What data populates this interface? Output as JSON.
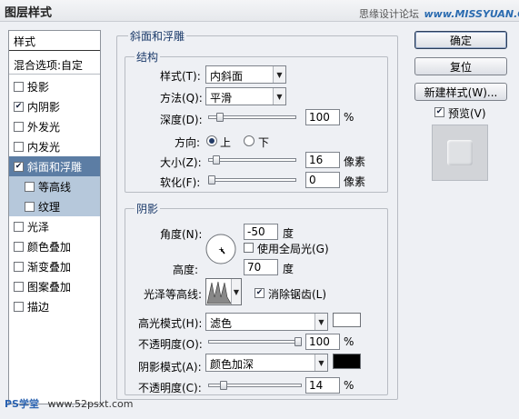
{
  "window": {
    "title": "图层样式"
  },
  "watermark": {
    "text": "思缘设计论坛",
    "site": "www.MISSYUAN.COM"
  },
  "sidebar": {
    "header": "样式",
    "blend_options": "混合选项:自定",
    "items": [
      {
        "label": "投影",
        "checked": false
      },
      {
        "label": "内阴影",
        "checked": true
      },
      {
        "label": "外发光",
        "checked": false
      },
      {
        "label": "内发光",
        "checked": false
      },
      {
        "label": "斜面和浮雕",
        "checked": true,
        "selected": true
      },
      {
        "label": "等高线",
        "checked": false,
        "sub": true
      },
      {
        "label": "纹理",
        "checked": false,
        "sub": true
      },
      {
        "label": "光泽",
        "checked": false
      },
      {
        "label": "颜色叠加",
        "checked": false
      },
      {
        "label": "渐变叠加",
        "checked": false
      },
      {
        "label": "图案叠加",
        "checked": false
      },
      {
        "label": "描边",
        "checked": false
      }
    ]
  },
  "bevel": {
    "group_title": "斜面和浮雕",
    "structure": {
      "title": "结构",
      "style_label": "样式(T):",
      "style_value": "内斜面",
      "technique_label": "方法(Q):",
      "technique_value": "平滑",
      "depth_label": "深度(D):",
      "depth_value": "100",
      "depth_unit": "%",
      "depth_level": 0.1,
      "direction_label": "方向:",
      "direction_up": "上",
      "direction_down": "下",
      "size_label": "大小(Z):",
      "size_value": "16",
      "size_unit": "像素",
      "size_level": 0.06,
      "soften_label": "软化(F):",
      "soften_value": "0",
      "soften_unit": "像素",
      "soften_level": 0.0
    },
    "shading": {
      "title": "阴影",
      "angle_label": "角度(N):",
      "angle_value": "-50",
      "angle_unit": "度",
      "global_light_label": "使用全局光(G)",
      "altitude_label": "高度:",
      "altitude_value": "70",
      "altitude_unit": "度",
      "gloss_label": "光泽等高线:",
      "antialias_label": "消除锯齿(L)",
      "highlight_mode_label": "高光模式(H):",
      "highlight_mode_value": "滤色",
      "highlight_color": "#ffffff",
      "highlight_opacity_label": "不透明度(O):",
      "highlight_opacity_value": "100",
      "highlight_opacity_level": 1.0,
      "shadow_mode_label": "阴影模式(A):",
      "shadow_mode_value": "颜色加深",
      "shadow_color": "#000000",
      "shadow_opacity_label": "不透明度(C):",
      "shadow_opacity_value": "14",
      "shadow_opacity_level": 0.14,
      "percent": "%"
    }
  },
  "buttons": {
    "ok": "确定",
    "reset": "复位",
    "new_style": "新建样式(W)...",
    "preview": "预览(V)"
  },
  "bottom_watermark": {
    "brand": "PS学堂",
    "site": "www.52psxt.com"
  },
  "colors": {
    "accent": "#1b3a6a",
    "selection": "#5c7da4",
    "sub_item": "#b6c8db"
  }
}
